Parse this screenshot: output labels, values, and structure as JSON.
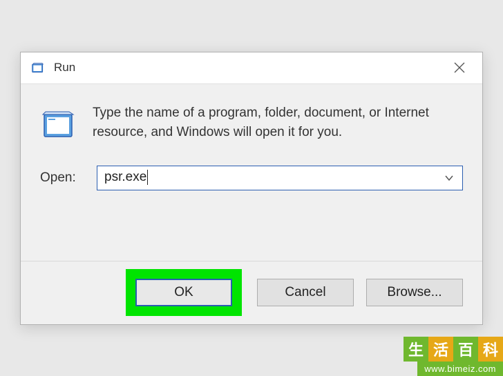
{
  "titlebar": {
    "title": "Run"
  },
  "body": {
    "description": "Type the name of a program, folder, document, or Internet resource, and Windows will open it for you.",
    "open_label": "Open:",
    "input_value": "psr.exe"
  },
  "buttons": {
    "ok": "OK",
    "cancel": "Cancel",
    "browse": "Browse..."
  },
  "watermark": {
    "chars": [
      "生",
      "活",
      "百",
      "科"
    ],
    "url": "www.bimeiz.com"
  }
}
